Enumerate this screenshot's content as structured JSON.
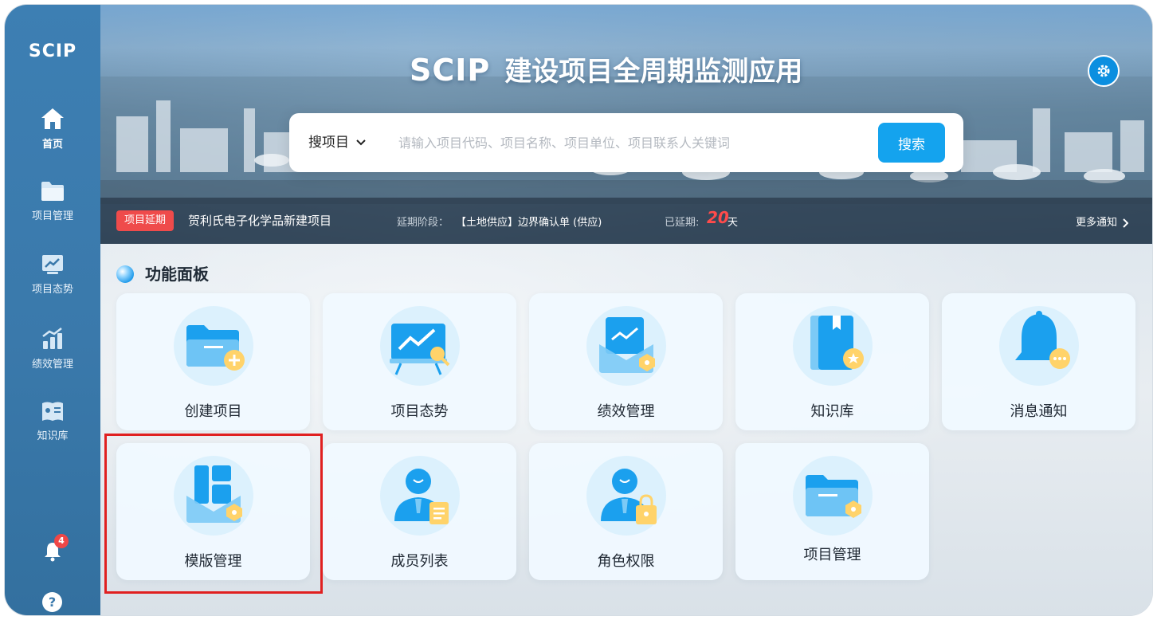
{
  "sidebar": {
    "logo": "SCIP",
    "items": [
      {
        "label": "首页",
        "icon": "home-icon",
        "active": true
      },
      {
        "label": "项目管理",
        "icon": "folder-icon"
      },
      {
        "label": "项目态势",
        "icon": "trend-icon"
      },
      {
        "label": "绩效管理",
        "icon": "bar-chart-icon"
      },
      {
        "label": "知识库",
        "icon": "book-icon"
      }
    ],
    "notification_count": "4",
    "help_label": "?"
  },
  "header": {
    "brand": "SCIP",
    "title": "建设项目全周期监测应用"
  },
  "search": {
    "type_label": "搜项目",
    "placeholder": "请输入项目代码、项目名称、项目单位、项目联系人关键词",
    "button_label": "搜索"
  },
  "notice": {
    "tag": "项目延期",
    "project": "贺利氏电子化学品新建项目",
    "stage_label": "延期阶段：",
    "stage": "【土地供应】边界确认单 (供应)",
    "delay_label": "已延期:",
    "delay_days": "20",
    "delay_unit": "天",
    "more_label": "更多通知"
  },
  "panel": {
    "title": "功能面板",
    "cards": [
      {
        "label": "创建项目",
        "icon": "folder-add-icon"
      },
      {
        "label": "项目态势",
        "icon": "trend-board-icon"
      },
      {
        "label": "绩效管理",
        "icon": "performance-icon"
      },
      {
        "label": "知识库",
        "icon": "knowledge-book-icon"
      },
      {
        "label": "消息通知",
        "icon": "bell-message-icon"
      },
      {
        "label": "模版管理",
        "icon": "template-icon"
      },
      {
        "label": "成员列表",
        "icon": "member-list-icon"
      },
      {
        "label": "角色权限",
        "icon": "role-lock-icon"
      },
      {
        "label": "项目管理",
        "icon": "project-folder-icon"
      }
    ]
  },
  "colors": {
    "sidebar": "#3a79ab",
    "accent": "#14a3ee",
    "alert": "#ef4b4b",
    "highlight": "#e02020"
  }
}
